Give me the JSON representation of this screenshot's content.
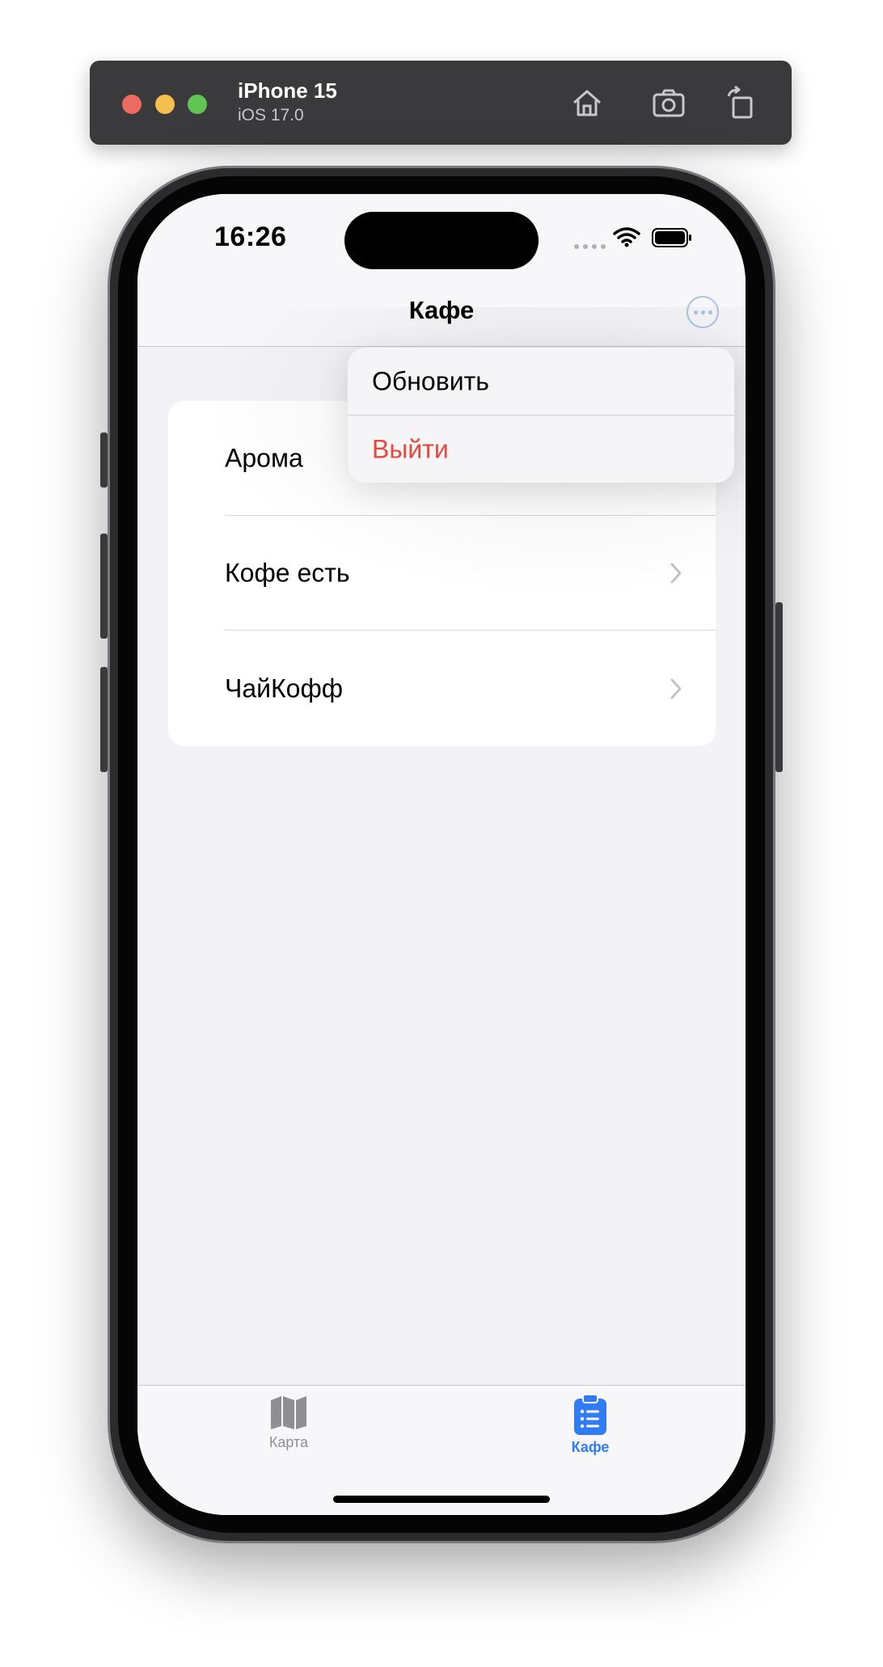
{
  "simulator": {
    "device_name": "iPhone 15",
    "os_version": "iOS 17.0",
    "buttons": [
      "home-icon",
      "screenshot-icon",
      "rotate-icon"
    ]
  },
  "status_bar": {
    "time": "16:26"
  },
  "navbar": {
    "title": "Кафе",
    "more_icon": "ellipsis-circle-icon"
  },
  "context_menu": {
    "items": [
      {
        "label": "Обновить",
        "color": "#000000"
      },
      {
        "label": "Выйти",
        "color": "#e5483c"
      }
    ]
  },
  "cafe_list": {
    "items": [
      {
        "label": "Арома"
      },
      {
        "label": "Кофе есть"
      },
      {
        "label": "ЧайКофф"
      }
    ]
  },
  "tabbar": {
    "tabs": [
      {
        "label": "Карта",
        "icon": "map-icon",
        "selected": false,
        "color": "#8e8e93"
      },
      {
        "label": "Кафе",
        "icon": "list-clipboard-icon",
        "selected": true,
        "color": "#2f7cf6"
      }
    ]
  },
  "colors": {
    "accent": "#2f7cf6",
    "destructive": "#e5483c",
    "background": "#f2f2f7"
  }
}
